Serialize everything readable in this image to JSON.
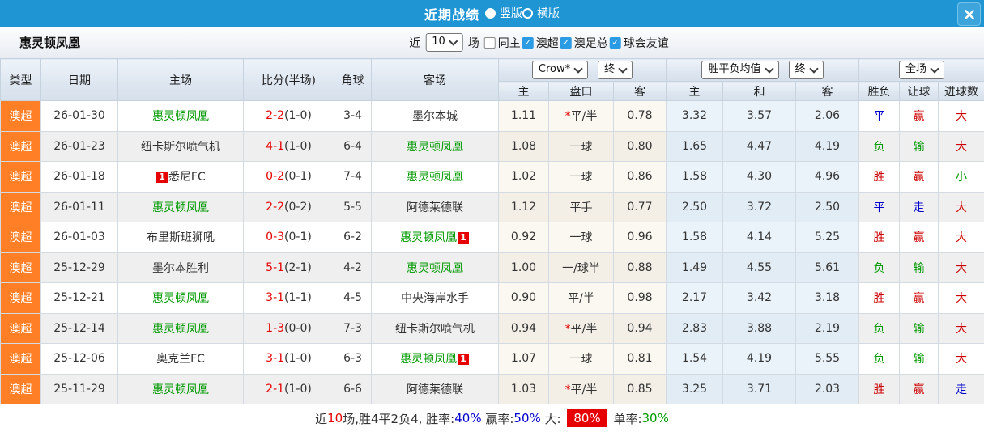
{
  "titlebar": {
    "title": "近期战绩",
    "radio_options": [
      {
        "label": "竖版",
        "selected": true
      },
      {
        "label": "横版",
        "selected": false
      }
    ]
  },
  "filterbar": {
    "team_name": "惠灵顿凤凰",
    "recent_label": "近",
    "recent_count": "10",
    "matches_label": "场",
    "checkboxes": [
      {
        "label": "同主",
        "checked": false
      },
      {
        "label": "澳超",
        "checked": true
      },
      {
        "label": "澳足总",
        "checked": true
      },
      {
        "label": "球会友谊",
        "checked": true
      }
    ]
  },
  "table": {
    "dropdowns": {
      "bookmaker": "Crow*",
      "bookmaker_state": "终",
      "avg": "胜平负均值",
      "avg_state": "终",
      "scope": "全场"
    },
    "columns": [
      "类型",
      "日期",
      "主场",
      "比分(半场)",
      "角球",
      "客场"
    ],
    "subcolumns": [
      "主",
      "盘口",
      "客",
      "主",
      "和",
      "客",
      "胜负",
      "让球",
      "进球数"
    ],
    "rows": [
      {
        "league": "澳超",
        "date": "26-01-30",
        "home": "惠灵顿凤凰",
        "home_green": true,
        "home_badge": "",
        "away": "墨尔本城",
        "away_green": false,
        "away_badge": "",
        "score": "2-2",
        "half": "(1-0)",
        "corner": "3-4",
        "odds": [
          "1.11",
          "*平/半",
          "0.78",
          "3.32",
          "3.57",
          "2.06"
        ],
        "results": [
          {
            "t": "平",
            "c": "blue"
          },
          {
            "t": "赢",
            "c": "red"
          },
          {
            "t": "大",
            "c": "red"
          }
        ]
      },
      {
        "league": "澳超",
        "date": "26-01-23",
        "home": "纽卡斯尔喷气机",
        "home_green": false,
        "home_badge": "",
        "away": "惠灵顿凤凰",
        "away_green": true,
        "away_badge": "",
        "score": "4-1",
        "half": "(1-0)",
        "corner": "6-4",
        "odds": [
          "1.08",
          "一球",
          "0.80",
          "1.65",
          "4.47",
          "4.19"
        ],
        "results": [
          {
            "t": "负",
            "c": "green"
          },
          {
            "t": "输",
            "c": "green"
          },
          {
            "t": "大",
            "c": "red"
          }
        ]
      },
      {
        "league": "澳超",
        "date": "26-01-18",
        "home": "悉尼FC",
        "home_green": false,
        "home_badge": "1",
        "away": "惠灵顿凤凰",
        "away_green": true,
        "away_badge": "",
        "score": "0-2",
        "half": "(0-1)",
        "corner": "7-4",
        "odds": [
          "1.02",
          "一球",
          "0.86",
          "1.58",
          "4.30",
          "4.96"
        ],
        "results": [
          {
            "t": "胜",
            "c": "red"
          },
          {
            "t": "赢",
            "c": "red"
          },
          {
            "t": "小",
            "c": "green"
          }
        ]
      },
      {
        "league": "澳超",
        "date": "26-01-11",
        "home": "惠灵顿凤凰",
        "home_green": true,
        "home_badge": "",
        "away": "阿德莱德联",
        "away_green": false,
        "away_badge": "",
        "score": "2-2",
        "half": "(0-2)",
        "corner": "5-5",
        "odds": [
          "1.12",
          "平手",
          "0.77",
          "2.50",
          "3.72",
          "2.50"
        ],
        "results": [
          {
            "t": "平",
            "c": "blue"
          },
          {
            "t": "走",
            "c": "blue"
          },
          {
            "t": "大",
            "c": "red"
          }
        ]
      },
      {
        "league": "澳超",
        "date": "26-01-03",
        "home": "布里斯班狮吼",
        "home_green": false,
        "home_badge": "",
        "away": "惠灵顿凤凰",
        "away_green": true,
        "away_badge": "1",
        "score": "0-3",
        "half": "(0-1)",
        "corner": "6-2",
        "odds": [
          "0.92",
          "一球",
          "0.96",
          "1.58",
          "4.14",
          "5.25"
        ],
        "results": [
          {
            "t": "胜",
            "c": "red"
          },
          {
            "t": "赢",
            "c": "red"
          },
          {
            "t": "大",
            "c": "red"
          }
        ]
      },
      {
        "league": "澳超",
        "date": "25-12-29",
        "home": "墨尔本胜利",
        "home_green": false,
        "home_badge": "",
        "away": "惠灵顿凤凰",
        "away_green": true,
        "away_badge": "",
        "score": "5-1",
        "half": "(2-1)",
        "corner": "4-2",
        "odds": [
          "1.00",
          "一/球半",
          "0.88",
          "1.49",
          "4.55",
          "5.61"
        ],
        "results": [
          {
            "t": "负",
            "c": "green"
          },
          {
            "t": "输",
            "c": "green"
          },
          {
            "t": "大",
            "c": "red"
          }
        ]
      },
      {
        "league": "澳超",
        "date": "25-12-21",
        "home": "惠灵顿凤凰",
        "home_green": true,
        "home_badge": "",
        "away": "中央海岸水手",
        "away_green": false,
        "away_badge": "",
        "score": "3-1",
        "half": "(1-1)",
        "corner": "4-5",
        "odds": [
          "0.90",
          "平/半",
          "0.98",
          "2.17",
          "3.42",
          "3.18"
        ],
        "results": [
          {
            "t": "胜",
            "c": "red"
          },
          {
            "t": "赢",
            "c": "red"
          },
          {
            "t": "大",
            "c": "red"
          }
        ]
      },
      {
        "league": "澳超",
        "date": "25-12-14",
        "home": "惠灵顿凤凰",
        "home_green": true,
        "home_badge": "",
        "away": "纽卡斯尔喷气机",
        "away_green": false,
        "away_badge": "",
        "score": "1-3",
        "half": "(0-0)",
        "corner": "7-3",
        "odds": [
          "0.94",
          "*平/半",
          "0.94",
          "2.83",
          "3.88",
          "2.19"
        ],
        "results": [
          {
            "t": "负",
            "c": "green"
          },
          {
            "t": "输",
            "c": "green"
          },
          {
            "t": "大",
            "c": "red"
          }
        ]
      },
      {
        "league": "澳超",
        "date": "25-12-06",
        "home": "奥克兰FC",
        "home_green": false,
        "home_badge": "",
        "away": "惠灵顿凤凰",
        "away_green": true,
        "away_badge": "1",
        "score": "3-1",
        "half": "(1-0)",
        "corner": "6-3",
        "odds": [
          "1.07",
          "一球",
          "0.81",
          "1.54",
          "4.19",
          "5.55"
        ],
        "results": [
          {
            "t": "负",
            "c": "green"
          },
          {
            "t": "输",
            "c": "green"
          },
          {
            "t": "大",
            "c": "red"
          }
        ]
      },
      {
        "league": "澳超",
        "date": "25-11-29",
        "home": "惠灵顿凤凰",
        "home_green": true,
        "home_badge": "",
        "away": "阿德莱德联",
        "away_green": false,
        "away_badge": "",
        "score": "2-1",
        "half": "(1-0)",
        "corner": "6-6",
        "odds": [
          "1.03",
          "*平/半",
          "0.85",
          "3.25",
          "3.71",
          "2.03"
        ],
        "results": [
          {
            "t": "胜",
            "c": "red"
          },
          {
            "t": "赢",
            "c": "red"
          },
          {
            "t": "走",
            "c": "blue"
          }
        ]
      }
    ]
  },
  "summary": {
    "segments": [
      {
        "text": "近",
        "color": "#333333"
      },
      {
        "text": "10",
        "color": "#e60000"
      },
      {
        "text": "场,胜4平2负4, 胜率:",
        "color": "#333333"
      },
      {
        "text": "40%",
        "color": "#0000cc"
      },
      {
        "text": " 赢率:",
        "color": "#333333"
      },
      {
        "text": "50%",
        "color": "#0000cc"
      },
      {
        "text": " 大: ",
        "color": "#333333"
      },
      {
        "text": "80%",
        "color": "#ffffff",
        "bg": "#e60000"
      },
      {
        "text": " 单率:",
        "color": "#333333"
      },
      {
        "text": "30%",
        "color": "#009900"
      }
    ]
  },
  "colors": {
    "accent_blue": "#1f95d4",
    "league_orange": "#ff7f26",
    "team_green": "#009900",
    "score_red": "#e60000",
    "win_red": "#cc0000",
    "draw_blue": "#0000cc",
    "lose_green": "#009900"
  }
}
